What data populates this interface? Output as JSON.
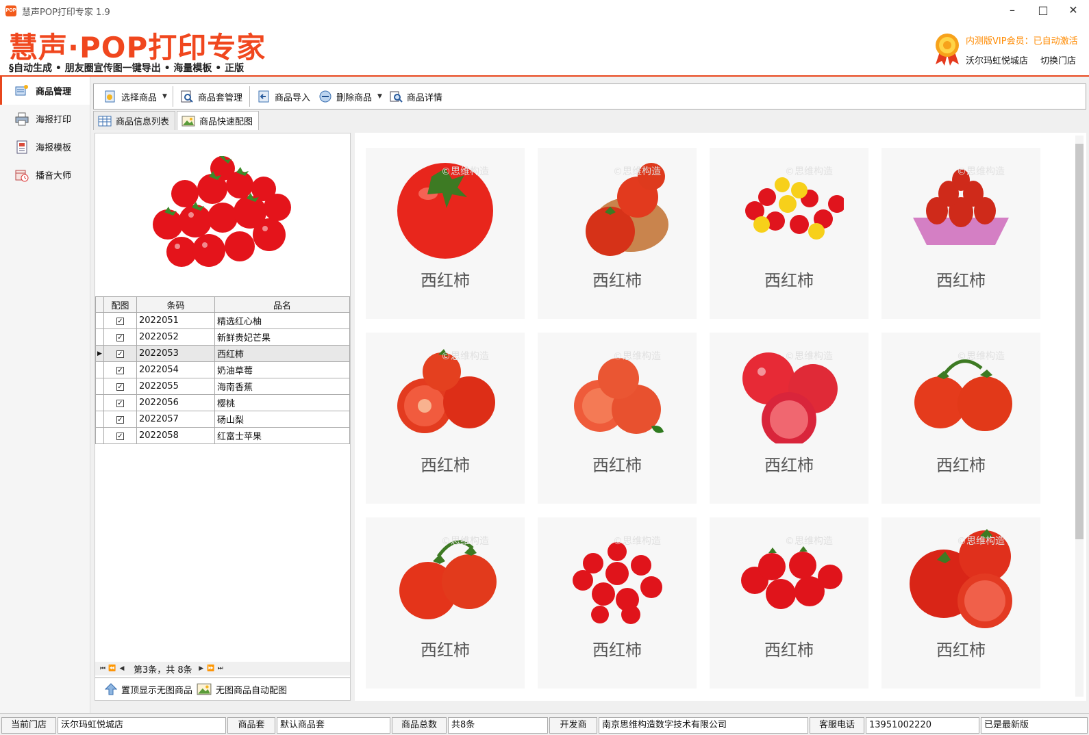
{
  "window": {
    "app_icon_text": "POP",
    "title": "慧声POP打印专家 1.9"
  },
  "header": {
    "logo_text": "慧声·POP打印专家",
    "tagline": "§自动生成 • 朋友圈宣传图一键导出 • 海量模板 • 正版",
    "vip_text": "内测版VIP会员：已自动激活",
    "store_name": "沃尔玛虹悦城店",
    "switch_store": "切换门店"
  },
  "nav": {
    "items": [
      {
        "label": "商品管理",
        "icon": "product-manage-icon",
        "active": true
      },
      {
        "label": "海报打印",
        "icon": "printer-icon",
        "active": false
      },
      {
        "label": "海报模板",
        "icon": "template-icon",
        "active": false
      },
      {
        "label": "播音大师",
        "icon": "broadcast-icon",
        "active": false
      }
    ]
  },
  "toolbar": {
    "select_goods": "选择商品",
    "goods_set": "商品套管理",
    "import": "商品导入",
    "delete": "删除商品",
    "details": "商品详情"
  },
  "tabs": [
    {
      "label": "商品信息列表",
      "active": false
    },
    {
      "label": "商品快速配图",
      "active": true
    }
  ],
  "table": {
    "headers": [
      "配图",
      "条码",
      "品名"
    ],
    "rows": [
      {
        "checked": true,
        "code": "2022051",
        "name": "精选红心柚"
      },
      {
        "checked": true,
        "code": "2022052",
        "name": "新鲜贵妃芒果"
      },
      {
        "checked": true,
        "code": "2022053",
        "name": "西红柿",
        "selected": true
      },
      {
        "checked": true,
        "code": "2022054",
        "name": "奶油草莓"
      },
      {
        "checked": true,
        "code": "2022055",
        "name": "海南香蕉"
      },
      {
        "checked": true,
        "code": "2022056",
        "name": "樱桃"
      },
      {
        "checked": true,
        "code": "2022057",
        "name": "砀山梨"
      },
      {
        "checked": true,
        "code": "2022058",
        "name": "红富士苹果"
      }
    ]
  },
  "pager": {
    "text": "第3条，共 8条"
  },
  "bottom_actions": {
    "top_no_image": "置顶显示无图商品",
    "auto_match": "无图商品自动配图"
  },
  "images": {
    "label": "西红柿",
    "watermark": "©思维构造",
    "count": 12
  },
  "statusbar": {
    "store_label": "当前门店",
    "store_value": "沃尔玛虹悦城店",
    "set_label": "商品套",
    "set_value": "默认商品套",
    "total_label": "商品总数",
    "total_value": "共8条",
    "dev_label": "开发商",
    "dev_value": "南京思维构造数字技术有限公司",
    "phone_label": "客服电话",
    "phone_value": "13951002220",
    "version_status": "已是最新版"
  },
  "colors": {
    "brand": "#f0471e",
    "vip": "#ff8a00"
  }
}
